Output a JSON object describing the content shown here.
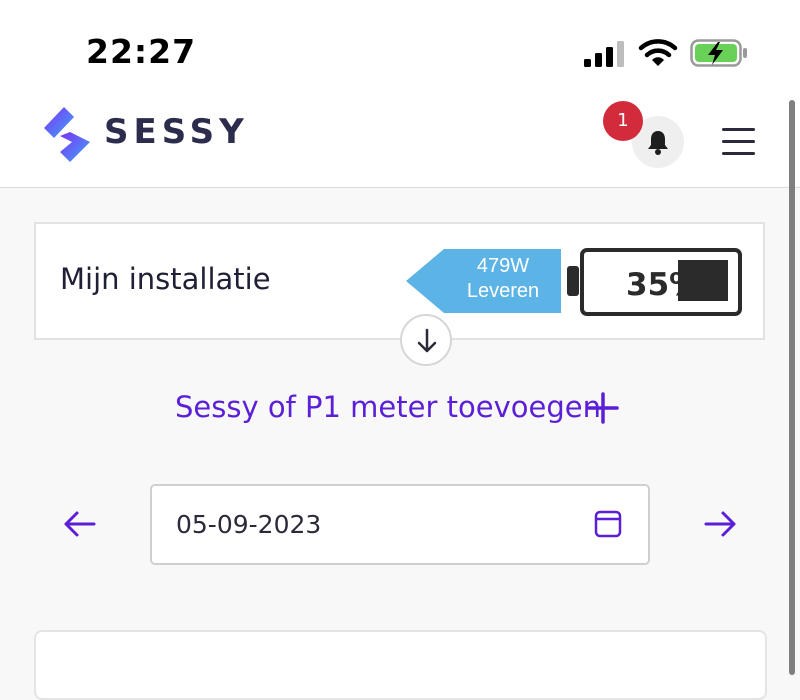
{
  "status_bar": {
    "time": "22:27",
    "battery_color": "#6ad158"
  },
  "header": {
    "brand": "SESSY",
    "notification_count": "1",
    "brand_colors": [
      "#7b2ff7",
      "#3fa9f5"
    ]
  },
  "installation": {
    "title": "Mijn installatie",
    "power": "479W",
    "mode": "Leveren",
    "flow_color": "#5cb3e6",
    "battery_percent": "35%",
    "battery_level": 0.35
  },
  "actions": {
    "add_label": "Sessy of P1 meter toevoegen",
    "accent_color": "#5a1fd6"
  },
  "date_picker": {
    "value": "05-09-2023"
  }
}
